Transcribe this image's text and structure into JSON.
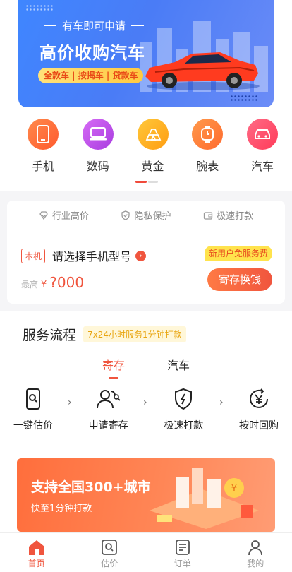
{
  "banner": {
    "subtitle": "有车即可申请",
    "title": "高价收购汽车",
    "tags": "全款车 | 按揭车 | 贷款车"
  },
  "categories": [
    {
      "label": "手机",
      "icon": "phone-icon",
      "color": "#ff6a3d"
    },
    {
      "label": "数码",
      "icon": "laptop-icon",
      "color": "#c64dea"
    },
    {
      "label": "黄金",
      "icon": "gold-icon",
      "color": "#ffb21a"
    },
    {
      "label": "腕表",
      "icon": "watch-icon",
      "color": "#ff7a3d"
    },
    {
      "label": "汽车",
      "icon": "car-icon",
      "color": "#ff4b6b"
    }
  ],
  "valuation": {
    "features": [
      "行业高价",
      "隐私保护",
      "极速打款"
    ],
    "tag": "本机",
    "model_prompt": "请选择手机型号",
    "new_user_badge": "新用户免服务费",
    "max_label": "最高",
    "currency": "¥",
    "price": "?000",
    "button": "寄存换钱"
  },
  "service": {
    "title": "服务流程",
    "badge": "7x24小时服务1分钟打款",
    "tabs": [
      "寄存",
      "汽车"
    ],
    "steps": [
      "一键估价",
      "申请寄存",
      "极速打款",
      "按时回购"
    ]
  },
  "promo": {
    "title": "支持全国300+城市",
    "subtitle": "快至1分钟打款"
  },
  "tabbar": [
    "首页",
    "估价",
    "订单",
    "我的"
  ],
  "colors": {
    "accent": "#f0553e",
    "banner_blue": "#4a7cf6",
    "promo_orange": "#ff7a45"
  }
}
